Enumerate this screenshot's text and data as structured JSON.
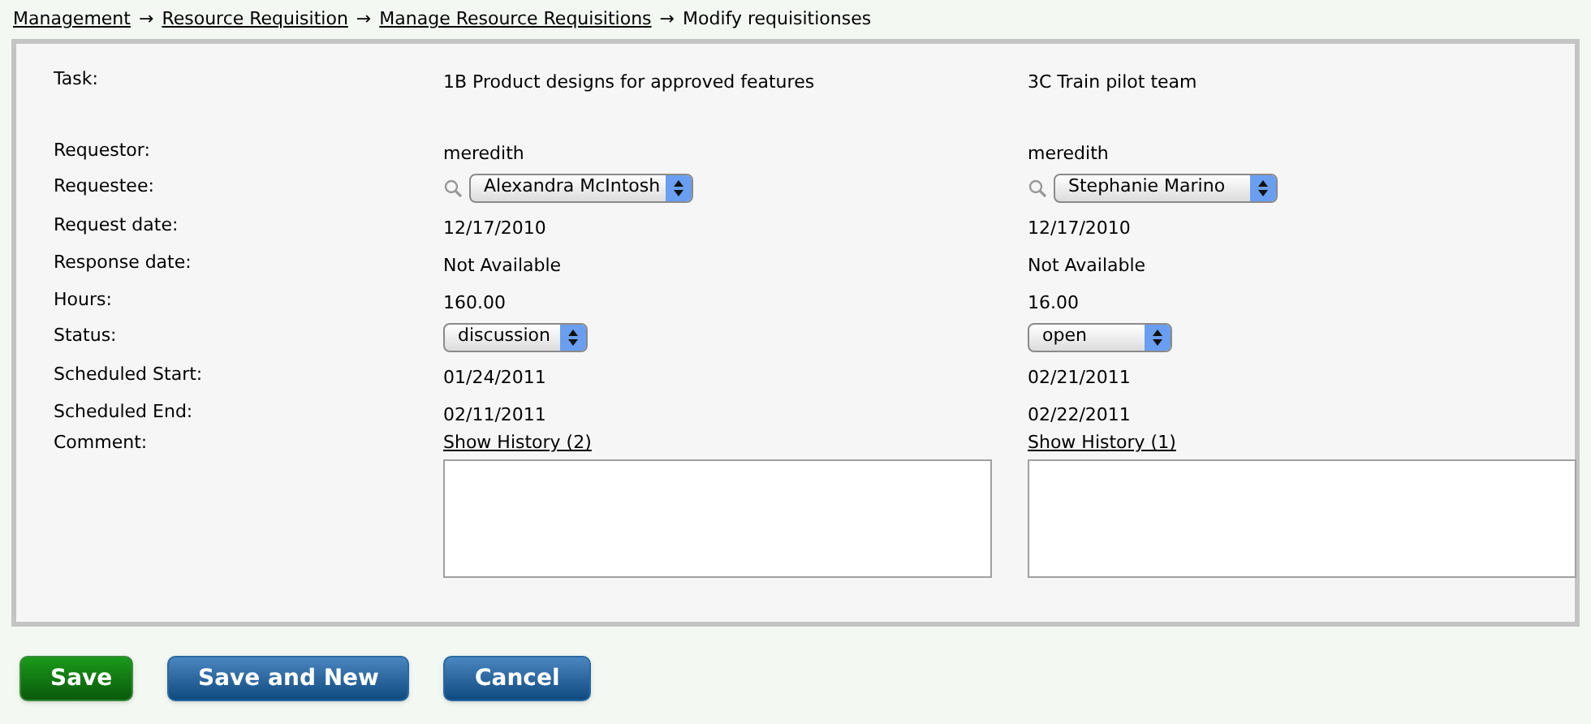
{
  "breadcrumb": [
    {
      "label": "Management",
      "kind": "link"
    },
    {
      "label": "Resource Requisition",
      "kind": "link"
    },
    {
      "label": "Manage Resource Requisitions",
      "kind": "link"
    },
    {
      "label": "Modify requisitionses",
      "kind": "current"
    }
  ],
  "separator": "→",
  "rows": [
    {
      "label": "Task:",
      "kind": "title",
      "values": [
        "1B Product designs for approved features",
        "3C Train pilot team"
      ]
    },
    {
      "label": "Requestor:",
      "kind": "text",
      "values": [
        "meredith",
        "meredith"
      ]
    },
    {
      "label": "Requestee:",
      "kind": "person",
      "values": [
        "Alexandra McIntosh",
        "Stephanie Marino"
      ]
    },
    {
      "label": "Request date:",
      "kind": "text",
      "values": [
        "12/17/2010",
        "12/17/2010"
      ]
    },
    {
      "label": "Response date:",
      "kind": "text",
      "values": [
        "Not Available",
        "Not Available"
      ]
    },
    {
      "label": "Hours:",
      "kind": "text",
      "values": [
        "160.00",
        "16.00"
      ]
    },
    {
      "label": "Status:",
      "kind": "select",
      "values": [
        "discussion",
        "open"
      ]
    },
    {
      "label": "Scheduled Start:",
      "kind": "text",
      "values": [
        "01/24/2011",
        "02/21/2011"
      ]
    },
    {
      "label": "Scheduled End:",
      "kind": "text",
      "values": [
        "02/11/2011",
        "02/22/2011"
      ]
    },
    {
      "label": "Comment:",
      "kind": "comment",
      "values": [
        "Show History (2)",
        "Show History (1)"
      ]
    }
  ],
  "buttons": [
    {
      "label": "Save",
      "kind": "primary"
    },
    {
      "label": "Save and New",
      "kind": "secondary"
    },
    {
      "label": "Cancel",
      "kind": "secondary"
    }
  ]
}
